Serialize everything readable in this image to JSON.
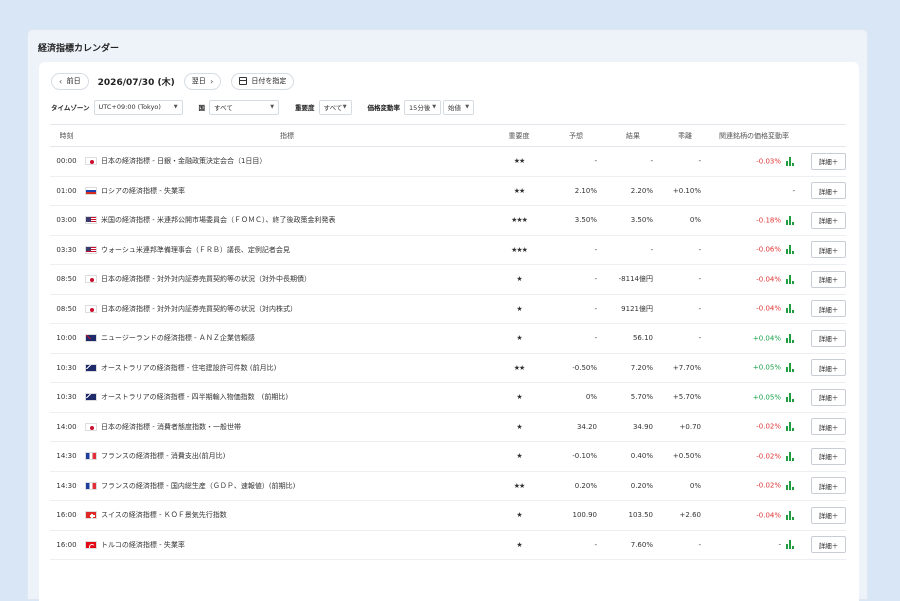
{
  "page": {
    "title": "経済指標カレンダー"
  },
  "datebar": {
    "prev_label": "前日",
    "date": "2026/07/30 (木)",
    "next_label": "翌日",
    "pick_label": "日付を指定"
  },
  "filters": {
    "timezone": {
      "label": "タイムゾーン",
      "value": "UTC+09:00 (Tokyo)"
    },
    "country": {
      "label": "国",
      "value": "すべて"
    },
    "importance": {
      "label": "重要度",
      "value": "すべて"
    },
    "price_change": {
      "label": "価格変動率",
      "period": "15分後",
      "mode": "始値"
    }
  },
  "table": {
    "headers": [
      "時刻",
      "指標",
      "重要度",
      "予想",
      "結果",
      "乖離",
      "関連銘柄の価格変動率",
      ""
    ],
    "detail_label": "詳細＋",
    "rows": [
      {
        "time": "00:00",
        "flag": "jp",
        "name": "日本の経済指標 - 日銀・金融政策決定会合（1日目）",
        "importance": "★★",
        "forecast": "-",
        "actual": "-",
        "deviation": "-",
        "deviation_tone": "neu",
        "related": "-0.03%",
        "related_tone": "neg",
        "chart": true
      },
      {
        "time": "01:00",
        "flag": "ru",
        "name": "ロシアの経済指標 - 失業率",
        "importance": "★★",
        "forecast": "2.10%",
        "actual": "2.20%",
        "deviation": "+0.10%",
        "deviation_tone": "pos",
        "related": "-",
        "related_tone": "neu",
        "chart": false
      },
      {
        "time": "03:00",
        "flag": "us",
        "name": "米国の経済指標 - 米連邦公開市場委員会（ＦＯＭＣ）、終了後政策金利発表",
        "importance": "★★★",
        "forecast": "3.50%",
        "actual": "3.50%",
        "deviation": "0%",
        "deviation_tone": "neu",
        "related": "-0.18%",
        "related_tone": "neg",
        "chart": true
      },
      {
        "time": "03:30",
        "flag": "us",
        "name": "ウォーシュ米連邦準備理事会（ＦＲＢ）議長、定例記者会見",
        "importance": "★★★",
        "forecast": "-",
        "actual": "-",
        "deviation": "-",
        "deviation_tone": "neu",
        "related": "-0.06%",
        "related_tone": "neg",
        "chart": true
      },
      {
        "time": "08:50",
        "flag": "jp",
        "name": "日本の経済指標 - 対外対内証券売買契約等の状況（対外中長期債）",
        "importance": "★",
        "forecast": "-",
        "actual": "-8114億円",
        "deviation": "-",
        "deviation_tone": "neu",
        "related": "-0.04%",
        "related_tone": "neg",
        "chart": true
      },
      {
        "time": "08:50",
        "flag": "jp",
        "name": "日本の経済指標 - 対外対内証券売買契約等の状況（対内株式）",
        "importance": "★",
        "forecast": "-",
        "actual": "9121億円",
        "deviation": "-",
        "deviation_tone": "neu",
        "related": "-0.04%",
        "related_tone": "neg",
        "chart": true
      },
      {
        "time": "10:00",
        "flag": "nz",
        "name": "ニュージーランドの経済指標 - ＡＮＺ企業信頼感",
        "importance": "★",
        "forecast": "-",
        "actual": "56.10",
        "deviation": "-",
        "deviation_tone": "neu",
        "related": "+0.04%",
        "related_tone": "pos",
        "chart": true
      },
      {
        "time": "10:30",
        "flag": "au",
        "name": "オーストラリアの経済指標 - 住宅建設許可件数 (前月比)",
        "importance": "★★",
        "forecast": "-0.50%",
        "actual": "7.20%",
        "deviation": "+7.70%",
        "deviation_tone": "pos",
        "related": "+0.05%",
        "related_tone": "pos",
        "chart": true
      },
      {
        "time": "10:30",
        "flag": "au",
        "name": "オーストラリアの経済指標 - 四半期輸入物価指数　(前期比)",
        "importance": "★",
        "forecast": "0%",
        "actual": "5.70%",
        "deviation": "+5.70%",
        "deviation_tone": "pos",
        "related": "+0.05%",
        "related_tone": "pos",
        "chart": true
      },
      {
        "time": "14:00",
        "flag": "jp",
        "name": "日本の経済指標 - 消費者態度指数・一般世帯",
        "importance": "★",
        "forecast": "34.20",
        "actual": "34.90",
        "deviation": "+0.70",
        "deviation_tone": "pos",
        "related": "-0.02%",
        "related_tone": "neg",
        "chart": true
      },
      {
        "time": "14:30",
        "flag": "fr",
        "name": "フランスの経済指標 - 消費支出(前月比)",
        "importance": "★",
        "forecast": "-0.10%",
        "actual": "0.40%",
        "deviation": "+0.50%",
        "deviation_tone": "pos",
        "related": "-0.02%",
        "related_tone": "neg",
        "chart": true
      },
      {
        "time": "14:30",
        "flag": "fr",
        "name": "フランスの経済指標 - 国内総生産（ＧＤＰ、速報値）(前期比)",
        "importance": "★★",
        "forecast": "0.20%",
        "actual": "0.20%",
        "deviation": "0%",
        "deviation_tone": "neu",
        "related": "-0.02%",
        "related_tone": "neg",
        "chart": true
      },
      {
        "time": "16:00",
        "flag": "ch",
        "name": "スイスの経済指標 - ＫＯＦ景気先行指数",
        "importance": "★",
        "forecast": "100.90",
        "actual": "103.50",
        "deviation": "+2.60",
        "deviation_tone": "pos",
        "related": "-0.04%",
        "related_tone": "neg",
        "chart": true
      },
      {
        "time": "16:00",
        "flag": "tr",
        "name": "トルコの経済指標 - 失業率",
        "importance": "★",
        "forecast": "-",
        "actual": "7.60%",
        "deviation": "-",
        "deviation_tone": "neu",
        "related": "-",
        "related_tone": "neu",
        "chart": true
      }
    ]
  }
}
